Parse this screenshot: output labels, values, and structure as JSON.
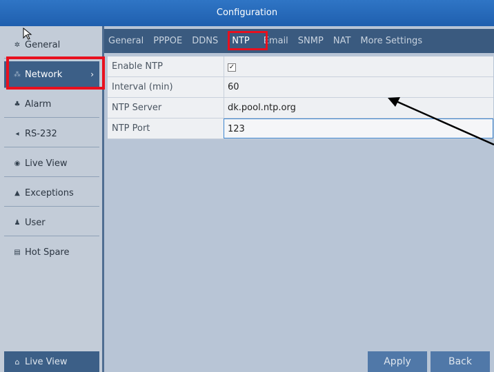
{
  "title": "Configuration",
  "sidebar": {
    "items": [
      {
        "label": "General",
        "icon": "gear-icon"
      },
      {
        "label": "Network",
        "icon": "network-icon"
      },
      {
        "label": "Alarm",
        "icon": "alarm-icon"
      },
      {
        "label": "RS-232",
        "icon": "serial-port-icon"
      },
      {
        "label": "Live View",
        "icon": "eye-icon"
      },
      {
        "label": "Exceptions",
        "icon": "warning-icon"
      },
      {
        "label": "User",
        "icon": "users-icon"
      },
      {
        "label": "Hot Spare",
        "icon": "server-icon"
      }
    ],
    "bottom_label": "Live View"
  },
  "tabs": [
    "General",
    "PPPOE",
    "DDNS",
    "NTP",
    "Email",
    "SNMP",
    "NAT",
    "More Settings"
  ],
  "form": {
    "enable_ntp_label": "Enable NTP",
    "enable_ntp_checked": "✓",
    "interval_label": "Interval (min)",
    "interval_value": "60",
    "server_label": "NTP Server",
    "server_value": "dk.pool.ntp.org",
    "port_label": "NTP Port",
    "port_value": "123"
  },
  "buttons": {
    "apply": "Apply",
    "back": "Back"
  },
  "colors": {
    "title_bar": "#1f5fae",
    "highlight_box": "#e8101e",
    "active_nav": "#3c5f87"
  }
}
